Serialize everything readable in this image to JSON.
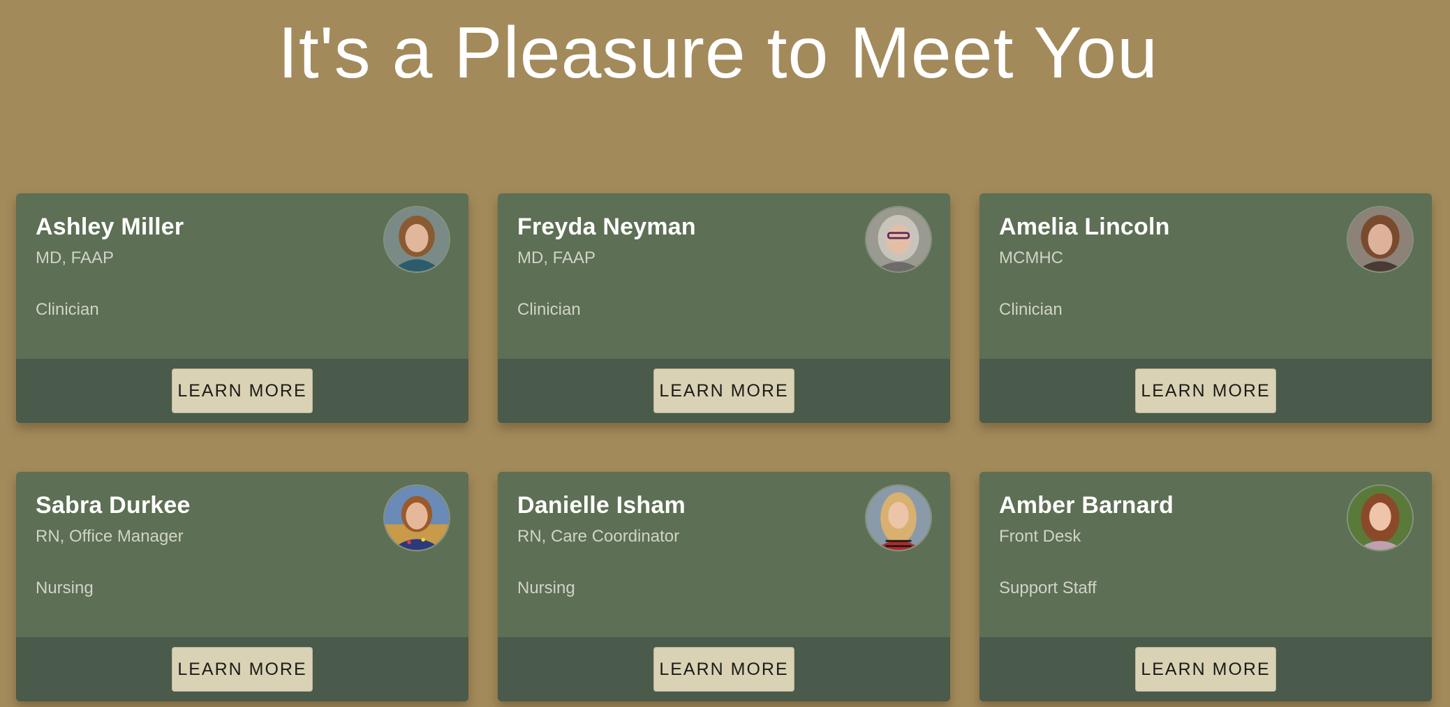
{
  "page": {
    "title": "It's a Pleasure to Meet You"
  },
  "colors": {
    "background": "#a38a5b",
    "card": "#5d6f54",
    "card_footer": "#4a5a4b",
    "button": "#d9d2b4"
  },
  "team": [
    {
      "name": "Ashley Miller",
      "credentials": "MD, FAAP",
      "role": "Clinician",
      "button_label": "LEARN MORE",
      "photo_alt": "Ashley Miller photo"
    },
    {
      "name": "Freyda Neyman",
      "credentials": "MD, FAAP",
      "role": "Clinician",
      "button_label": "LEARN MORE",
      "photo_alt": "Freyda Neyman photo"
    },
    {
      "name": "Amelia Lincoln",
      "credentials": "MCMHC",
      "role": "Clinician",
      "button_label": "LEARN MORE",
      "photo_alt": "Amelia Lincoln photo"
    },
    {
      "name": "Sabra Durkee",
      "credentials": "RN, Office Manager",
      "role": "Nursing",
      "button_label": "LEARN MORE",
      "photo_alt": "Sabra Durkee photo"
    },
    {
      "name": "Danielle Isham",
      "credentials": "RN, Care Coordinator",
      "role": "Nursing",
      "button_label": "LEARN MORE",
      "photo_alt": "Danielle Isham photo"
    },
    {
      "name": "Amber Barnard",
      "credentials": "Front Desk",
      "role": "Support Staff",
      "button_label": "LEARN MORE",
      "photo_alt": "Amber Barnard photo"
    }
  ]
}
